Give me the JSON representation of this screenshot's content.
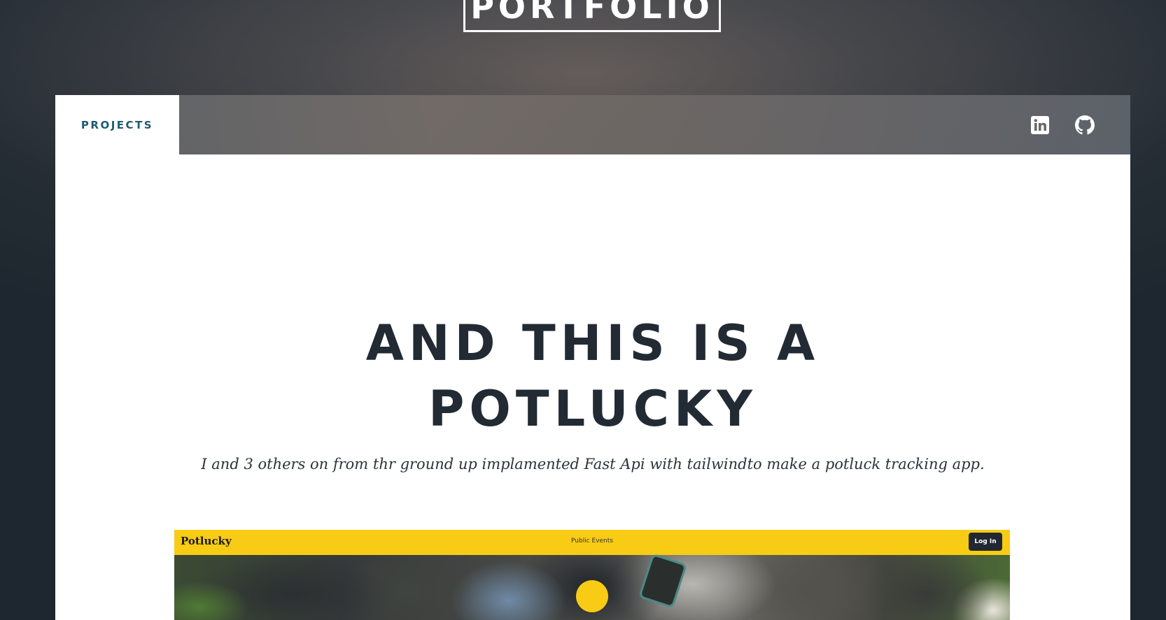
{
  "site": {
    "title": "PORTFOLIO"
  },
  "nav": {
    "tabs": [
      {
        "label": "PROJECTS",
        "active": true
      }
    ],
    "icons": [
      "linkedin-icon",
      "github-icon"
    ]
  },
  "project": {
    "headline_line1": "AND THIS IS A",
    "headline_line2": "POTLUCKY",
    "description": "I and 3 others on from thr ground up implamented Fast Api with tailwindto make a potluck tracking app.",
    "preview": {
      "logo": "Potlucky",
      "nav_link": "Public Events",
      "login_label": "Log In",
      "accent_color": "#f8cb15"
    }
  },
  "colors": {
    "nav_tab_text": "#1f5a70",
    "headline": "#222a33",
    "background": "#1f2830"
  }
}
